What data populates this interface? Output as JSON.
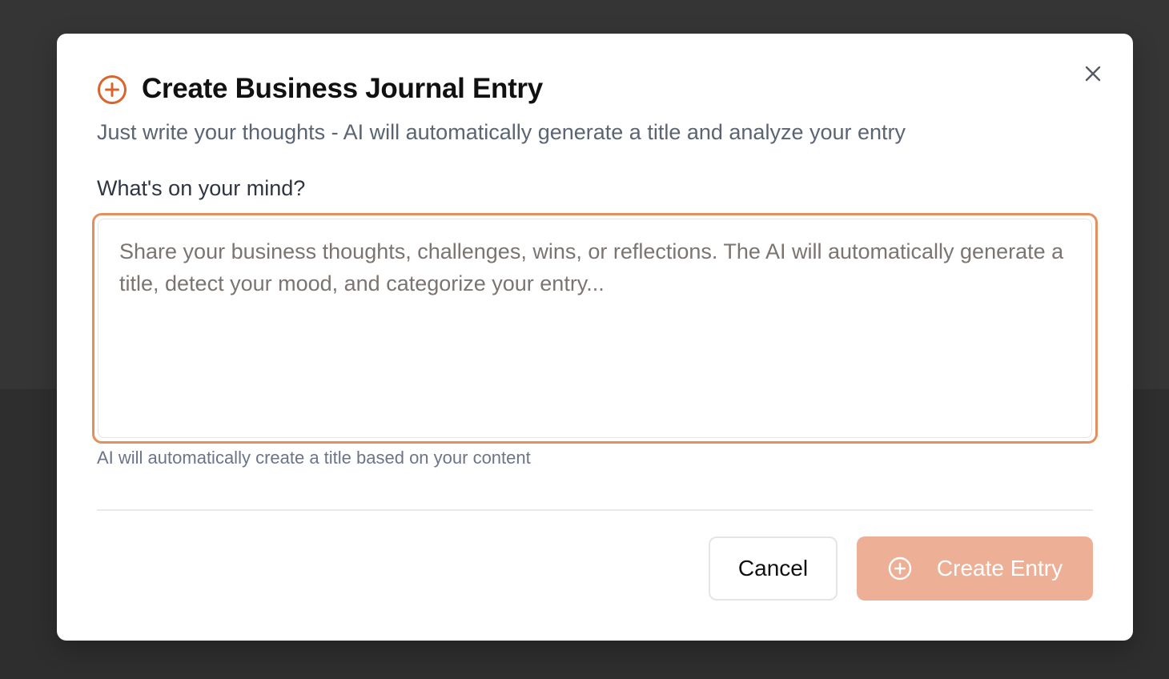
{
  "colors": {
    "accent": "#d9652b",
    "focus_ring": "#e3905e",
    "primary_button_disabled": "#edb096",
    "overlay": "#353535"
  },
  "dialog": {
    "title": "Create Business Journal Entry",
    "title_icon": "plus-circle-icon",
    "subtitle": "Just write your thoughts - AI will automatically generate a title and analyze your entry",
    "close_icon": "close-icon",
    "field": {
      "label": "What's on your mind?",
      "value": "",
      "placeholder": "Share your business thoughts, challenges, wins, or reflections. The AI will automatically generate a title, detect your mood, and categorize your entry...",
      "helper": "AI will automatically create a title based on your content"
    },
    "actions": {
      "cancel_label": "Cancel",
      "create_label": "Create Entry",
      "create_icon": "plus-circle-icon"
    }
  }
}
